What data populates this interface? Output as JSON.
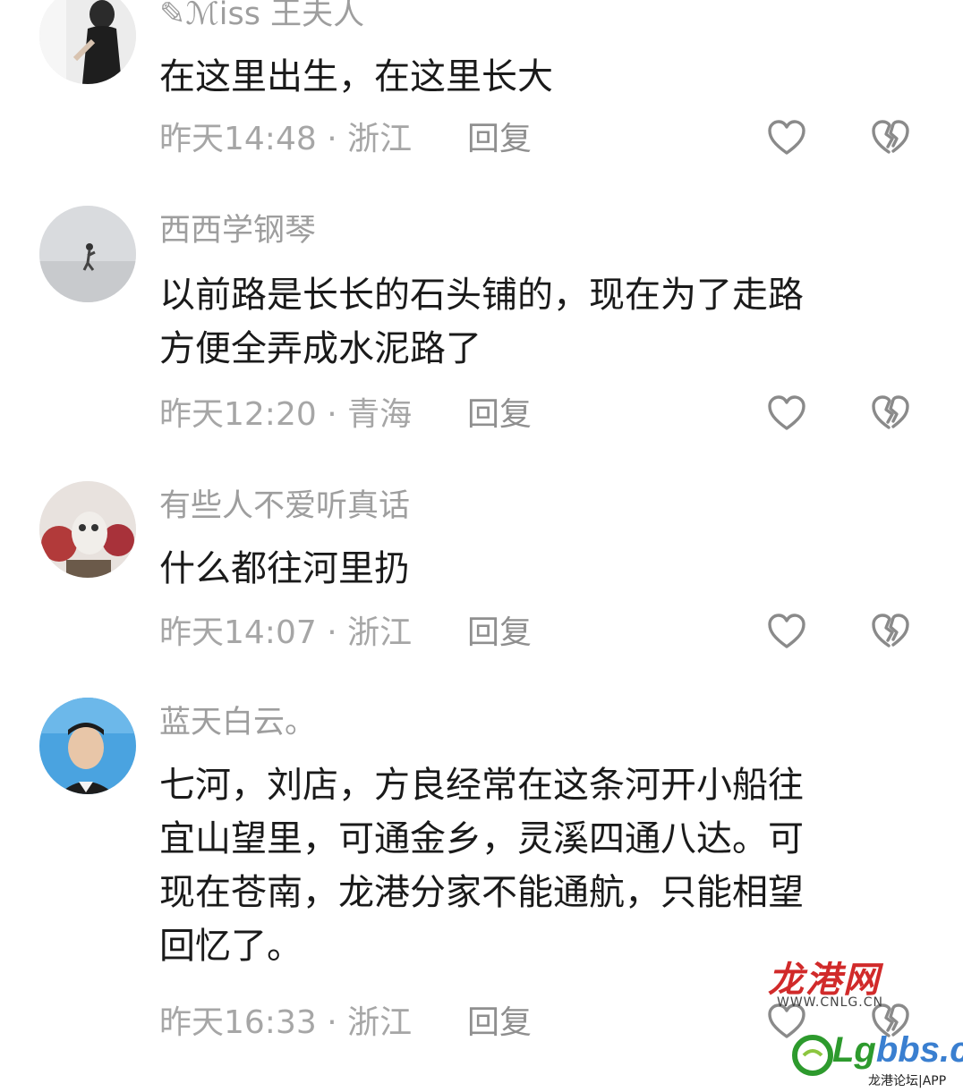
{
  "comments": [
    {
      "username": "✎ℳiss 王夫人",
      "text": "在这里出生，在这里长大",
      "time": "昨天14:48 · 浙江",
      "reply_label": "回复"
    },
    {
      "username": "西西学钢琴",
      "text": "以前路是长长的石头铺的，现在为了走路\n方便全弄成水泥路了",
      "time": "昨天12:20 · 青海",
      "reply_label": "回复"
    },
    {
      "username": "有些人不爱听真话",
      "text": "什么都往河里扔",
      "time": "昨天14:07 · 浙江",
      "reply_label": "回复"
    },
    {
      "username": "蓝天白云。",
      "text": "七河，刘店，方良经常在这条河开小船往\n宜山望里，可通金乡，灵溪四通八达。可\n现在苍南，龙港分家不能通航，只能相望\n回忆了。",
      "time": "昨天16:33 · 浙江",
      "reply_label": "回复"
    }
  ],
  "icons": {
    "like": "heart-outline-icon",
    "dislike": "broken-heart-outline-icon"
  },
  "colors": {
    "username": "#9e9e9e",
    "text": "#1a1a1a",
    "meta": "#a6a6a6",
    "icon": "#8a8a8a"
  },
  "watermark": {
    "site_name": "龙港网",
    "site_url": "WWW.CNLG.CN",
    "logo_brand_lg": "Lg",
    "logo_brand_bbs": "bbs.cn",
    "logo_sub": "龙港论坛|APP"
  }
}
